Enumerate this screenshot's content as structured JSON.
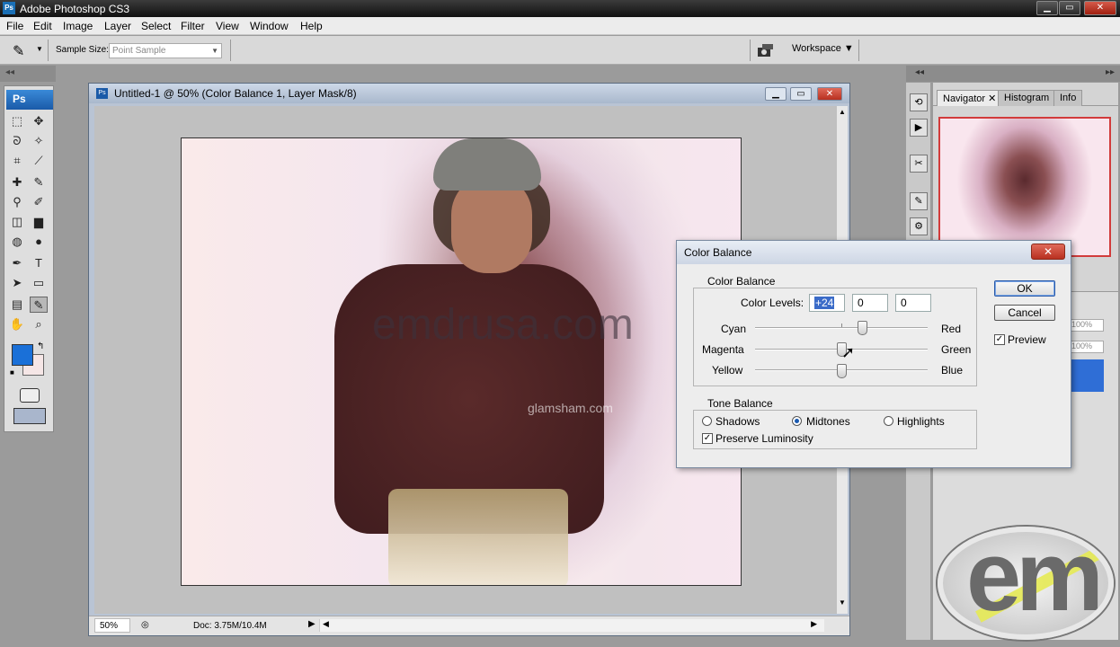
{
  "app": {
    "title": "Adobe Photoshop CS3",
    "icon": "Ps"
  },
  "window_controls": {
    "minimize": "▁",
    "restore": "▭",
    "close": "✕"
  },
  "menu": [
    "File",
    "Edit",
    "Image",
    "Layer",
    "Select",
    "Filter",
    "View",
    "Window",
    "Help"
  ],
  "options_bar": {
    "sample_size_label": "Sample Size:",
    "sample_size_value": "Point Sample",
    "workspace_label": "Workspace ▼"
  },
  "tools": {
    "logo": "Ps",
    "fg_color": "#1a70d8",
    "bg_color": "#f5e6e6"
  },
  "document": {
    "title": "Untitled-1 @ 50% (Color Balance 1, Layer Mask/8)",
    "zoom": "50%",
    "doc_info": "Doc: 3.75M/10.4M",
    "watermark": "emdrusa.com",
    "watermark2": "glamsham.com"
  },
  "navigator": {
    "tabs": [
      "Navigator",
      "Histogram",
      "Info"
    ],
    "zoom_values": [
      "100%",
      "100%"
    ]
  },
  "color_balance": {
    "title": "Color Balance",
    "close": "✕",
    "color_balance_group": "Color Balance",
    "color_levels_label": "Color Levels:",
    "levels": [
      "+24",
      "0",
      "0"
    ],
    "sliders": [
      {
        "left": "Cyan",
        "right": "Red",
        "value": 24
      },
      {
        "left": "Magenta",
        "right": "Green",
        "value": 0
      },
      {
        "left": "Yellow",
        "right": "Blue",
        "value": 0
      }
    ],
    "tone_balance_group": "Tone Balance",
    "tones": [
      "Shadows",
      "Midtones",
      "Highlights"
    ],
    "selected_tone": "Midtones",
    "preserve_luminosity": "Preserve Luminosity",
    "preserve_checked": true,
    "ok": "OK",
    "cancel": "Cancel",
    "preview": "Preview",
    "preview_checked": true
  },
  "logo_text": "em"
}
